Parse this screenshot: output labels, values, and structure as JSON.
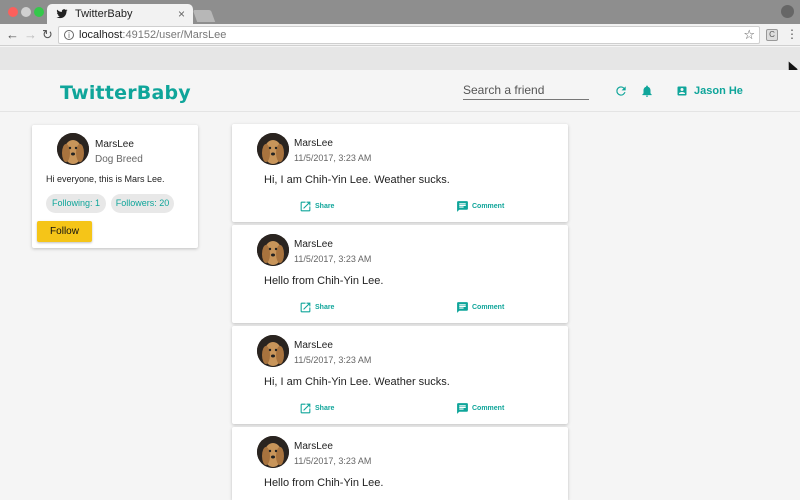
{
  "browser": {
    "tab_title": "TwitterBaby",
    "tab_close": "×",
    "url_host": "localhost",
    "url_rest": ":49152/user/MarsLee",
    "nav_back": "←",
    "nav_forward": "→",
    "nav_reload": "↻",
    "star": "☆",
    "menu": "⋮",
    "extension_letter": "C"
  },
  "header": {
    "logo": "TwitterBaby",
    "search_placeholder": "Search a friend",
    "user_name": "Jason He"
  },
  "profile": {
    "name": "MarsLee",
    "subtitle": "Dog Breed",
    "bio": "Hi everyone, this is Mars Lee.",
    "following_label": "Following: 1",
    "followers_label": "Followers: 20",
    "follow_button": "Follow"
  },
  "actions": {
    "share": "Share",
    "comment": "Comment"
  },
  "posts": [
    {
      "author": "MarsLee",
      "time": "11/5/2017, 3:23 AM",
      "text": "Hi, I am Chih-Yin Lee. Weather sucks."
    },
    {
      "author": "MarsLee",
      "time": "11/5/2017, 3:23 AM",
      "text": "Hello from Chih-Yin Lee."
    },
    {
      "author": "MarsLee",
      "time": "11/5/2017, 3:23 AM",
      "text": "Hi, I am Chih-Yin Lee. Weather sucks."
    },
    {
      "author": "MarsLee",
      "time": "11/5/2017, 3:23 AM",
      "text": "Hello from Chih-Yin Lee."
    }
  ],
  "colors": {
    "accent": "#0fa59a",
    "follow_button": "#f5c518"
  }
}
